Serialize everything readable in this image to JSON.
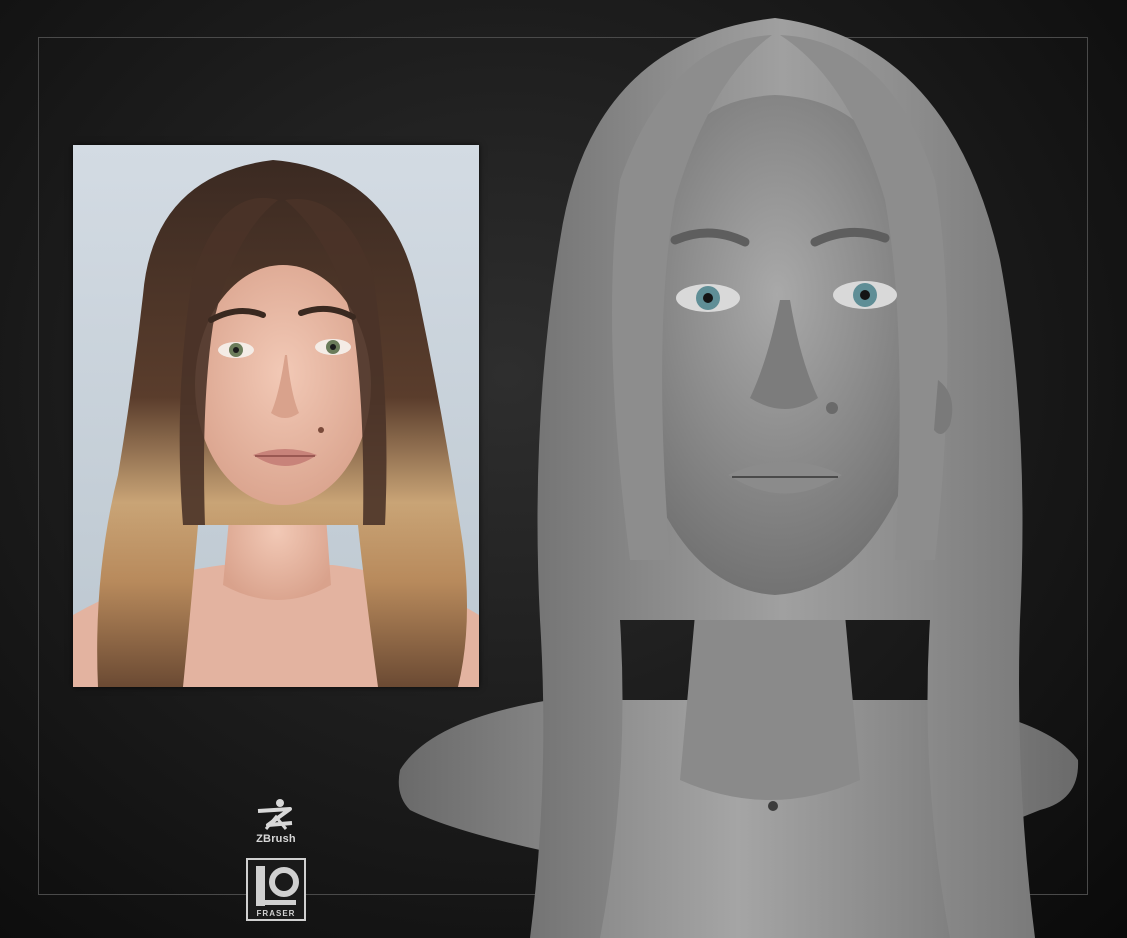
{
  "scene": {
    "description_free": true,
    "background_color": "#1d1d1d",
    "frame_color": "#4a4a4a"
  },
  "reference_photo": {
    "icon": "reference-photo",
    "background_color": "#c9d3dc",
    "hair_color": "#4a3328",
    "hair_tip_color": "#d8b98a",
    "skin_color": "#e8b8a4"
  },
  "sculpt": {
    "icon": "zbrush-bust-sculpt",
    "clay_color": "#8f8f8f",
    "eye_color": "#5f8e96"
  },
  "logos": {
    "zbrush_label": "ZBrush",
    "fraser_icon": "fraser-logo",
    "fraser_lettering": "FRASER"
  }
}
